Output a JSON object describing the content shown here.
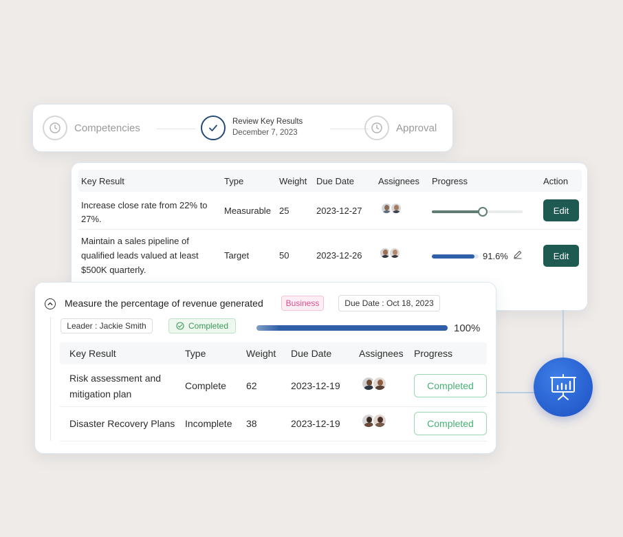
{
  "stepper": {
    "steps": [
      {
        "label": "Competencies"
      },
      {
        "label": "Review Key Results",
        "date": "December 7, 2023"
      },
      {
        "label": "Approval"
      }
    ]
  },
  "kr_table": {
    "headers": [
      "Key Result",
      "Type",
      "Weight",
      "Due Date",
      "Assignees",
      "Progress",
      "Action"
    ],
    "rows": [
      {
        "key_result_line1": "Increase close rate from 22% to",
        "key_result_line2": "27%.",
        "type": "Measurable",
        "weight": "25",
        "due": "2023-12-27",
        "progress_fraction": 0.56,
        "action": "Edit"
      },
      {
        "key_result_line1": "Maintain a sales pipeline of",
        "key_result_line2": "qualified leads valued at least",
        "key_result_line3": "$500K quarterly.",
        "type": "Target",
        "weight": "50",
        "due": "2023-12-26",
        "progress_value": "91.6%",
        "progress_fraction": 0.916,
        "action": "Edit"
      }
    ]
  },
  "detail": {
    "title": "Measure the percentage of revenue generated",
    "category_tag": "Business",
    "due_date": "Due Date : Oct 18, 2023",
    "leader": "Leader : Jackie Smith",
    "status": "Completed",
    "progress_value": "100%",
    "progress_fraction": 1.0,
    "headers": [
      "Key Result",
      "Type",
      "Weight",
      "Due Date",
      "Assignees",
      "Progress"
    ],
    "rows": [
      {
        "key_result_line1": "Risk assessment and",
        "key_result_line2": "mitigation plan",
        "type": "Complete",
        "weight": "62",
        "due": "2023-12-19",
        "progress": "Completed"
      },
      {
        "key_result_line1": "Disaster Recovery Plans",
        "type": "Incomplete",
        "weight": "38",
        "due": "2023-12-19",
        "progress": "Completed"
      }
    ]
  },
  "colors": {
    "accent_blue": "#2f5fa8",
    "edit_button": "#1f5a52",
    "completed_green": "#46b074",
    "business_tag": "#d94f8c"
  },
  "icons": [
    "clock-icon",
    "check-icon",
    "chevron-up-icon",
    "check-circle-icon",
    "pencil-icon",
    "presentation-chart-icon"
  ]
}
